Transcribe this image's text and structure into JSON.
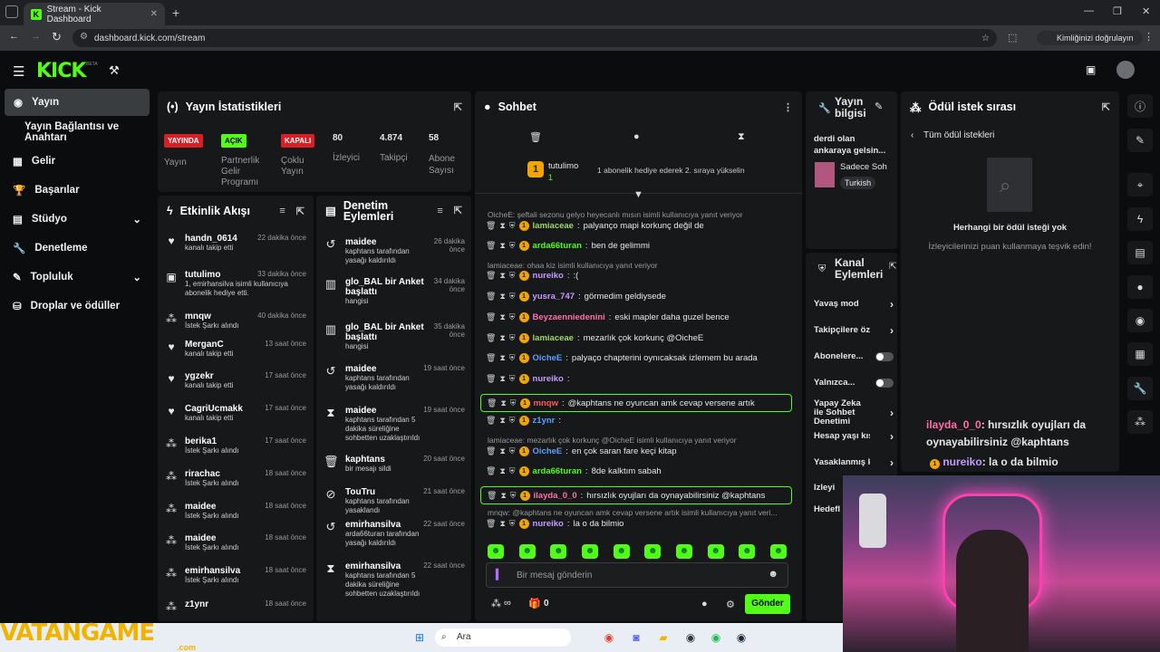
{
  "browser": {
    "tab_title": "Stream - Kick Dashboard",
    "url": "dashboard.kick.com/stream",
    "identity_chip": "Kimliğinizi doğrulayın"
  },
  "header": {
    "logo": "KICK",
    "beta": "BETA"
  },
  "nav": {
    "items": [
      "Yayın",
      "Yayın Bağlantısı ve Anahtarı",
      "Gelir",
      "Başarılar",
      "Stüdyo",
      "Denetleme",
      "Topluluk",
      "Droplar ve ödüller"
    ]
  },
  "stats": {
    "title": "Yayın İstatistikleri",
    "b1": "YAYINDA",
    "b2": "AÇIK",
    "b3": "KAPALI",
    "l1": "Yayın",
    "l2": "Partnerlik Gelir Programı",
    "l3": "Çoklu Yayın",
    "v1": "80",
    "v2": "4.874",
    "v3": "58",
    "l4": "İzleyici",
    "l5": "Takipçi",
    "l6": "Abone Sayısı"
  },
  "activity": {
    "title": "Etkinlik Akışı",
    "events": [
      {
        "name": "handn_0614",
        "time": "22 dakika önce",
        "sub": "kanalı takip etti",
        "icon": "♥"
      },
      {
        "name": "tutulimo",
        "time": "33 dakika önce",
        "sub": "1, emirhansilva isimli kullanıcıya abonelik hediye etti.",
        "icon": "▣"
      },
      {
        "name": "mnqw",
        "time": "40 dakika önce",
        "sub": "İstek Şarkı alındı",
        "icon": "⁂"
      },
      {
        "name": "MerganC",
        "time": "13 saat önce",
        "sub": "kanalı takip etti",
        "icon": "♥"
      },
      {
        "name": "ygzekr",
        "time": "17 saat önce",
        "sub": "kanalı takip etti",
        "icon": "♥"
      },
      {
        "name": "CagriUcmakk",
        "time": "17 saat önce",
        "sub": "kanalı takip etti",
        "icon": "♥"
      },
      {
        "name": "berika1",
        "time": "17 saat önce",
        "sub": "İstek Şarkı alındı",
        "icon": "⁂"
      },
      {
        "name": "rirachac",
        "time": "18 saat önce",
        "sub": "İstek Şarkı alındı",
        "icon": "⁂"
      },
      {
        "name": "maidee",
        "time": "18 saat önce",
        "sub": "İstek Şarkı alındı",
        "icon": "⁂"
      },
      {
        "name": "maidee",
        "time": "18 saat önce",
        "sub": "İstek Şarkı alındı",
        "icon": "⁂"
      },
      {
        "name": "emirhansilva",
        "time": "18 saat önce",
        "sub": "İstek Şarkı alındı",
        "icon": "⁂"
      },
      {
        "name": "z1ynr",
        "time": "18 saat önce",
        "sub": "",
        "icon": "⁂"
      }
    ]
  },
  "moderation": {
    "title": "Denetim Eylemleri",
    "items": [
      {
        "name": "maidee",
        "time": "26 dakika önce",
        "sub": "kaphtans tarafından yasağı kaldırıldı",
        "icon": "↺"
      },
      {
        "name": "glo_BAL bir Anket başlattı",
        "time": "34 dakika önce",
        "sub": "hangisi",
        "icon": "▥"
      },
      {
        "name": "glo_BAL bir Anket başlattı",
        "time": "35 dakika önce",
        "sub": "hangisi",
        "icon": "▥"
      },
      {
        "name": "maidee",
        "time": "19 saat önce",
        "sub": "kaphtans tarafından yasağı kaldırıldı",
        "icon": "↺"
      },
      {
        "name": "maidee",
        "time": "19 saat önce",
        "sub": "kaphtans tarafından 5 dakika süreliğine sohbetten uzaklaştırıldı",
        "icon": "⧗"
      },
      {
        "name": "kaphtans",
        "time": "20 saat önce",
        "sub": "bir mesajı sildi",
        "icon": "🗑"
      },
      {
        "name": "TouTru",
        "time": "21 saat önce",
        "sub": "kaphtans tarafından yasaklandı",
        "icon": "⊘"
      },
      {
        "name": "emirhansilva",
        "time": "22 saat önce",
        "sub": "arda66turan tarafından yasağı kaldırıldı",
        "icon": "↺"
      },
      {
        "name": "emirhansilva",
        "time": "22 saat önce",
        "sub": "kaphtans tarafından 5 dakika süreliğine sohbetten uzaklaştırıldı",
        "icon": "⧗"
      }
    ]
  },
  "chat": {
    "title": "Sohbet",
    "gifter_name": "tutulimo",
    "gifter_count": "1",
    "gift_hint": "1 abonelik hediye ederek 2. sıraya yükselin",
    "messages": [
      {
        "reply": "OicheE: şeftali sezonu gelyo heyecanlı mısın isimli kullanıcıya yanıt veriyor"
      },
      {
        "user": "lamiaceae",
        "color": "#9ed86a",
        "text": "palyanço mapi korkunç değil de"
      },
      {
        "user": "arda66turan",
        "color": "#53fc18",
        "text": "ben de gelimmi"
      },
      {
        "reply": "lamiaceae: ohaa kiz isimli kullanıcıya yanıt veriyor"
      },
      {
        "user": "nureiko",
        "color": "#c59bff",
        "text": ":("
      },
      {
        "user": "yusra_747",
        "color": "#c59bff",
        "text": "görmedim geldiysede"
      },
      {
        "user": "Beyzaenniedenini",
        "color": "#ff6fa8",
        "text": "eski mapler daha guzel bence"
      },
      {
        "user": "lamiaceae",
        "color": "#9ed86a",
        "text": "mezarlık çok korkunç @OicheE"
      },
      {
        "user": "OicheE",
        "color": "#5aa0ff",
        "text": "palyaço chapterini oynıcaksak izlemem bu arada"
      },
      {
        "user": "nureiko",
        "color": "#c59bff",
        "text": ""
      },
      {
        "user": "mnqw",
        "color": "#ff5a5a",
        "text": "@kaphtans ne oyuncan amk cevap versene artık"
      },
      {
        "user": "z1ynr",
        "color": "#5aa0ff",
        "text": ""
      },
      {
        "reply": "lamiaceae: mezarlık çok korkunç @OicheE isimli kullanıcıya yanıt veriyor"
      },
      {
        "user": "OicheE",
        "color": "#5aa0ff",
        "text": "en çok saran fare keçi kitap"
      },
      {
        "user": "arda66turan",
        "color": "#53fc18",
        "text": "8de kalktım sabah"
      },
      {
        "user": "ilayda_0_0",
        "color": "#ff6fa8",
        "text": "hırsızlık oyujları da oynayabilirsiniz @kaphtans"
      },
      {
        "reply": "mnqw: @kaphtans ne oyuncan amk cevap versene artık isimli kullanıcıya yanıt veri..."
      },
      {
        "user": "nureiko",
        "color": "#c59bff",
        "text": "la o da bilmio"
      }
    ],
    "input_placeholder": "Bir mesaj gönderin",
    "points": "∞",
    "gift_count": "0",
    "send": "Gönder"
  },
  "streaminfo": {
    "title": "Yayın bilgisi",
    "desc": "derdi olan ankaraya gelsin...",
    "category": "Sadece Soh",
    "tag": "Turkish"
  },
  "channel": {
    "title": "Kanal Eylemleri",
    "items": [
      "Yavaş mod",
      "Takipçilere öze",
      "Abonelere...",
      "Yalnızca...",
      "Yapay Zeka ile Sohbet Denetimi",
      "Hesap yaşı kıs",
      "Yasaklanmış k",
      "İzleyi",
      "Hedefl"
    ]
  },
  "rewards": {
    "title": "Ödül istek sırası",
    "back": "Tüm ödül istekleri",
    "empty": "Herhangi bir ödül isteği yok",
    "hint": "İzleyicilerinizi puan kullanmaya teşvik edin!"
  },
  "overlay": {
    "l1_user": "ilayda_0_0",
    "l1_text": ": hırsızlık oyujları da",
    "l2": "oynayabilirsiniz @kaphtans",
    "l3_user": "nureiko",
    "l3_text": ": la o da bilmio"
  },
  "taskbar": {
    "search": "Ara",
    "watermark": "VATANGAME",
    "watermark_sub": ".com"
  }
}
